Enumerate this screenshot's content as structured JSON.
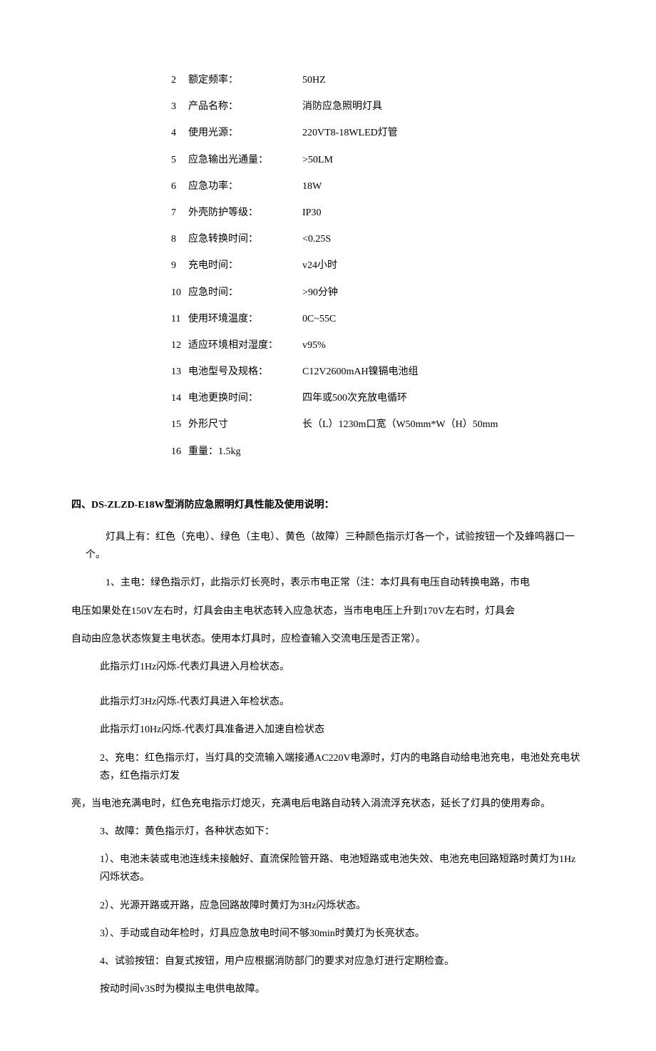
{
  "specs": [
    {
      "num": "2",
      "label": "额定频率：",
      "value": "50HZ"
    },
    {
      "num": "3",
      "label": "产品名称：",
      "value": "消防应急照明灯具"
    },
    {
      "num": "4",
      "label": "使用光源：",
      "value": "220VT8-18WLED灯管"
    },
    {
      "num": "5",
      "label": "应急输出光通量：",
      "value": ">50LM"
    },
    {
      "num": "6",
      "label": "应急功率：",
      "value": "18W"
    },
    {
      "num": "7",
      "label": "外壳防护等级：",
      "value": "IP30"
    },
    {
      "num": "8",
      "label": "应急转换时间：",
      "value": "<0.25S"
    },
    {
      "num": "9",
      "label": "充电时间：",
      "value": "v24小时"
    },
    {
      "num": "10",
      "label": "应急时间：",
      "value": ">90分钟"
    },
    {
      "num": "11",
      "label": "使用环境温度：",
      "value": "0C~55C"
    },
    {
      "num": "12",
      "label": "适应环境相对湿度：",
      "value": "v95%"
    },
    {
      "num": "13",
      "label": "电池型号及规格：",
      "value": "C12V2600mAH镍镉电池组"
    },
    {
      "num": "14",
      "label": "电池更换时间：",
      "value": "四年或500次充放电循环"
    },
    {
      "num": "15",
      "label": "外形尺寸",
      "value": "长（L）1230m口宽（W50mm*W（H）50mm"
    },
    {
      "num": "16",
      "label": "重量：1.5kg",
      "value": ""
    }
  ],
  "section4": {
    "title": "四、DS-ZLZD-E18W型消防应急照明灯具性能及使用说明：",
    "intro": "灯具上有：红色（充电）、绿色（主电）、黄色（故障）三种颜色指示灯各一个，试验按钮一个及蜂鸣器口一个。",
    "p1a": "1、主电：绿色指示灯，此指示灯长亮时，表示市电正常（注：本灯具有电压自动转换电路，市电",
    "p1b": "电压如果处在150V左右时，灯具会由主电状态转入应急状态，当市电电压上升到170V左右时，灯具会",
    "p1c": "自动由应急状态恢复主电状态。使用本灯具时，应检查输入交流电压是否正常）。",
    "p1d": "此指示灯1Hz闪烁-代表灯具进入月检状态。",
    "p1e": "此指示灯3Hz闪烁-代表灯具进入年检状态。",
    "p1f": "此指示灯10Hz闪烁-代表灯具准备进入加速自检状态",
    "p2a": "2、充电：红色指示灯，当灯具的交流输入端接通AC220V电源时，灯内的电路自动给电池充电，电池处充电状态，红色指示灯发",
    "p2b": "亮，当电池充满电时，红色充电指示灯熄灭，充满电后电路自动转入涓流浮充状态，延长了灯具的使用寿命。",
    "p3": "3、故障：黄色指示灯，各种状态如下：",
    "p3_1": "1）、电池未装或电池连线未接触好、直流保险管开路、电池短路或电池失效、电池充电回路短路时黄灯为1Hz闪烁状态。",
    "p3_2": "2）、光源开路或开路，应急回路故障时黄灯为3Hz闪烁状态。",
    "p3_3": "3）、手动或自动年检时，灯具应急放电时间不够30min时黄灯为长亮状态。",
    "p4a": "4、试验按钮：自复式按钮，用户应根据消防部门的要求对应急灯进行定期检查。",
    "p4b": "按动时间v3S时为模拟主电供电故障。"
  }
}
